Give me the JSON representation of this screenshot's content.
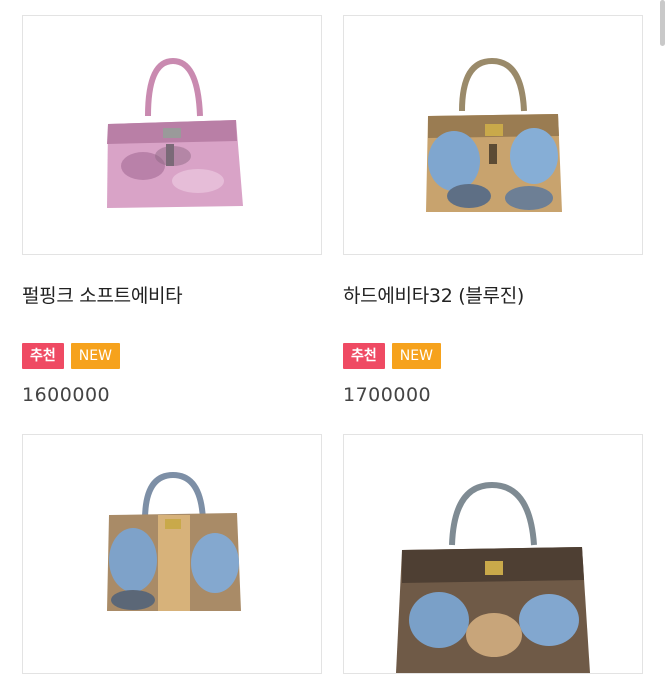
{
  "products": [
    {
      "name": "펄핑크 소프트에비타",
      "badges": {
        "recommend": "추천",
        "new": "NEW"
      },
      "price": "1600000",
      "image": "pink-python-handbag"
    },
    {
      "name": "하드에비타32 (블루진)",
      "badges": {
        "recommend": "추천",
        "new": "NEW"
      },
      "price": "1700000",
      "image": "blue-python-handbag"
    },
    {
      "image": "blue-tan-python-birkin-handbag"
    },
    {
      "image": "blue-brown-python-kelly-handbag"
    }
  ],
  "colors": {
    "recommend_badge": "#ef4a63",
    "new_badge": "#f6a21c",
    "border": "#e3e3e3"
  }
}
